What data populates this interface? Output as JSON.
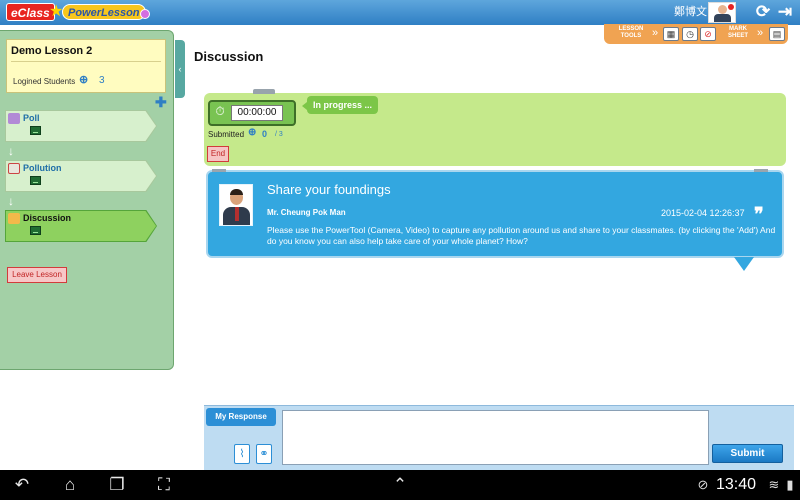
{
  "header": {
    "logo_eclass": "eClass",
    "logo_powerlesson": "PowerLesson",
    "user_name": "鄭博文"
  },
  "tools": {
    "lesson_tools_label": "LESSON TOOLS",
    "mark_sheet_label": "MARK SHEET"
  },
  "sidebar": {
    "lesson_title": "Demo Lesson 2",
    "logged_students_label": "Logined Students",
    "logged_students_count": "3",
    "steps": [
      {
        "label": "Poll",
        "active": false
      },
      {
        "label": "Pollution",
        "active": false
      },
      {
        "label": "Discussion",
        "active": true
      }
    ],
    "leave_label": "Leave Lesson"
  },
  "main": {
    "page_title": "Discussion",
    "timer": "00:00:00",
    "status": "In progress ...",
    "submitted_label": "Submitted",
    "submitted_count": "0",
    "submitted_total": "/ 3",
    "end_label": "End"
  },
  "card": {
    "title": "Share your foundings",
    "author": "Mr. Cheung Pok Man",
    "timestamp": "2015-02-04 12:26:37",
    "body": "Please use the PowerTool (Camera, Video) to capture any pollution around us and share to your classmates. (by clicking the 'Add') And do you know you can also help take care of your whole planet? How?"
  },
  "response": {
    "tab_label": "My Response",
    "input_value": "",
    "submit_label": "Submit"
  },
  "statusbar": {
    "time": "13:40"
  },
  "colors": {
    "topbar_blue": "#2f7fc4",
    "panel_green": "#a3d0a6",
    "card_blue": "#33a7e0",
    "progress_green": "#c5e98b",
    "tools_orange": "#f0a352"
  }
}
